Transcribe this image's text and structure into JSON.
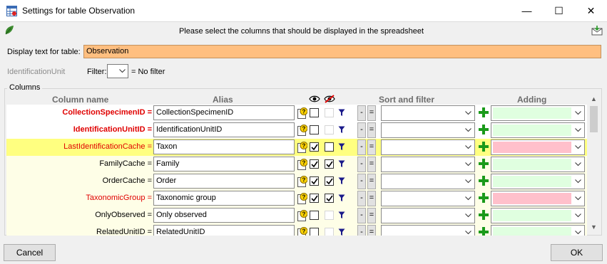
{
  "window": {
    "title": "Settings for table Observation",
    "controls": {
      "minimize": "—",
      "maximize": "☐",
      "close": "✕"
    }
  },
  "instruction": "Please select the columns that should be displayed in the spreadsheet",
  "display_text": {
    "label": "Display text for table:",
    "value": "Observation"
  },
  "filter_section": {
    "unit_label": "IdentificationUnit",
    "filter_label": "Filter:",
    "filter_value": "",
    "filter_hint": "= No filter"
  },
  "columns_group": {
    "title": "Columns",
    "headers": {
      "column_name": "Column name",
      "alias": "Alias",
      "sort_filter": "Sort and filter",
      "adding": "Adding"
    }
  },
  "rows": [
    {
      "name": "CollectionSpecimenID =",
      "alias": "CollectionSpecimenID",
      "visible": false,
      "visible_enabled": true,
      "hidden": false,
      "hidden_enabled": false,
      "add_color": "green",
      "name_color": "red",
      "bold": true
    },
    {
      "name": "IdentificationUnitID =",
      "alias": "IdentificationUnitID",
      "visible": false,
      "visible_enabled": true,
      "hidden": false,
      "hidden_enabled": false,
      "add_color": "green",
      "name_color": "red",
      "bold": true
    },
    {
      "name": "LastIdentificationCache =",
      "alias": "Taxon",
      "visible": true,
      "visible_enabled": true,
      "hidden": false,
      "hidden_enabled": true,
      "add_color": "pink",
      "name_color": "red",
      "bold": false
    },
    {
      "name": "FamilyCache =",
      "alias": "Family",
      "visible": true,
      "visible_enabled": true,
      "hidden": true,
      "hidden_enabled": true,
      "add_color": "green",
      "name_color": "black",
      "bold": false
    },
    {
      "name": "OrderCache =",
      "alias": "Order",
      "visible": true,
      "visible_enabled": true,
      "hidden": true,
      "hidden_enabled": true,
      "add_color": "green",
      "name_color": "black",
      "bold": false
    },
    {
      "name": "TaxonomicGroup =",
      "alias": "Taxonomic group",
      "visible": true,
      "visible_enabled": true,
      "hidden": true,
      "hidden_enabled": true,
      "add_color": "pink",
      "name_color": "red",
      "bold": false
    },
    {
      "name": "OnlyObserved =",
      "alias": "Only observed",
      "visible": false,
      "visible_enabled": true,
      "hidden": false,
      "hidden_enabled": false,
      "add_color": "green",
      "name_color": "black",
      "bold": false
    },
    {
      "name": "RelatedUnitID =",
      "alias": "RelatedUnitID",
      "visible": false,
      "visible_enabled": true,
      "hidden": false,
      "hidden_enabled": false,
      "add_color": "green",
      "name_color": "black",
      "bold": false
    }
  ],
  "row_icons": {
    "sort_minus": "-",
    "sort_equal": "="
  },
  "buttons": {
    "cancel": "Cancel",
    "ok": "OK"
  },
  "colors": {
    "display_field": "#ffbf80",
    "highlight_row": "#ffff80",
    "required_text": "#e00000",
    "add_plus": "#1a9a1a"
  }
}
